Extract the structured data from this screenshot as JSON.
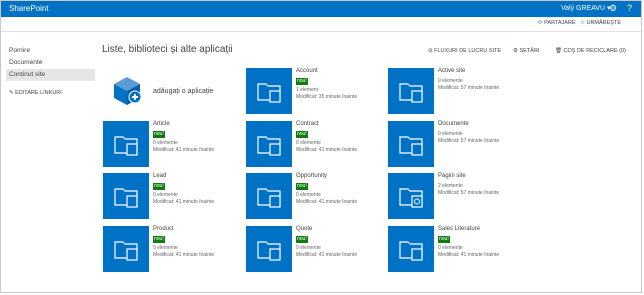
{
  "suite": {
    "brand": "SharePoint",
    "user": "Valý GREAVU ▾"
  },
  "ribbon": {
    "share": "PARTAJARE",
    "follow": "URMĂREȘTE"
  },
  "nav": {
    "items": [
      {
        "label": "Pornire"
      },
      {
        "label": "Documente"
      },
      {
        "label": "Conținut site"
      }
    ],
    "edit_links": "EDITARE LINKURI"
  },
  "main": {
    "title": "Liste, biblioteci și alte aplicații",
    "actions": {
      "workflows": "FLUXURI DE LUCRU SITE",
      "settings": "SETĂRI",
      "recycle": "COȘ DE RECICLARE (0)"
    },
    "add_app": "adăugați o aplicație"
  },
  "tiles": [
    {
      "name": "Account",
      "badge": "nou!",
      "count": "1 element",
      "modified": "Modificat: 35 minute înainte"
    },
    {
      "name": "Active site",
      "badge": "",
      "count": "0 elemente",
      "modified": "Modificat: 57 minute înainte"
    },
    {
      "name": "Article",
      "badge": "nou!",
      "count": "0 elemente",
      "modified": "Modificat: 41 minute înainte"
    },
    {
      "name": "Contract",
      "badge": "nou!",
      "count": "0 elemente",
      "modified": "Modificat: 41 minute înainte"
    },
    {
      "name": "Documente",
      "badge": "",
      "count": "0 elemente",
      "modified": "Modificat: 57 minute înainte"
    },
    {
      "name": "Lead",
      "badge": "nou!",
      "count": "0 elemente",
      "modified": "Modificat: 41 minute înainte"
    },
    {
      "name": "Opportunity",
      "badge": "nou!",
      "count": "0 elemente",
      "modified": "Modificat: 41 minute înainte"
    },
    {
      "name": "Pagini site",
      "badge": "",
      "count": "2 elemente",
      "modified": "Modificat: 57 minute înainte"
    },
    {
      "name": "Product",
      "badge": "nou!",
      "count": "0 elemente",
      "modified": "Modificat: 41 minute înainte"
    },
    {
      "name": "Quote",
      "badge": "nou!",
      "count": "0 elemente",
      "modified": "Modificat: 41 minute înainte"
    },
    {
      "name": "Sales Literature",
      "badge": "nou!",
      "count": "0 elemente",
      "modified": "Modificat: 41 minute înainte"
    }
  ],
  "colors": {
    "accent": "#0072c6",
    "badge": "#107c10"
  }
}
